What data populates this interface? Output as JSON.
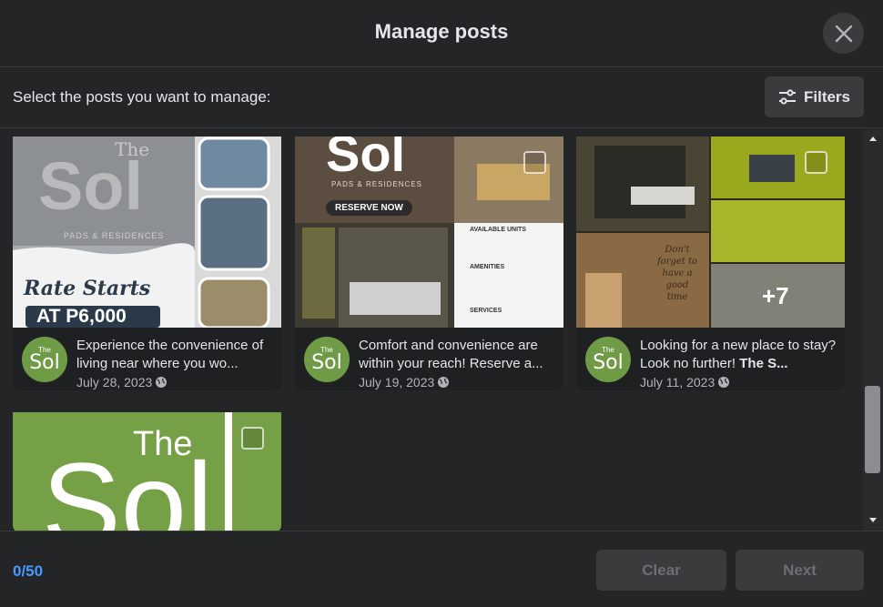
{
  "header": {
    "title": "Manage posts"
  },
  "subheader": {
    "text": "Select the posts you want to manage:",
    "filters_label": "Filters"
  },
  "posts": [
    {
      "caption": "Experience the convenience of living near where you wo...",
      "date": "July 28, 2023",
      "media": {
        "rate_text": "Rate Starts",
        "price_text": "AT P6,000",
        "brand_the": "The",
        "brand_sol": "Sol",
        "brand_sub": "PADS & RESIDENCES"
      }
    },
    {
      "caption": "Comfort and convenience are within your reach! Reserve a...",
      "date": "July 19, 2023",
      "media": {
        "brand_sol": "Sol",
        "brand_sub": "PADS & RESIDENCES",
        "reserve_text": "RESERVE NOW",
        "units_title": "AVAILABLE UNITS",
        "amenities_title": "AMENITIES",
        "services_title": "SERVICES"
      }
    },
    {
      "caption_plain": "Looking for a new place to stay? Look no further!",
      "caption_bold": "The S...",
      "date": "July 11, 2023",
      "media": {
        "more_count": "+7",
        "sign_text": "Don't forget to have a good time"
      }
    },
    {
      "media": {
        "brand_the": "The",
        "brand_sol": "Sol"
      }
    }
  ],
  "avatar": {
    "the": "The",
    "sol": "Sol"
  },
  "footer": {
    "count": "0/50",
    "clear_label": "Clear",
    "next_label": "Next"
  },
  "colors": {
    "background": "#242526",
    "accent": "#4599ff",
    "brand_green": "#6f9a46"
  }
}
